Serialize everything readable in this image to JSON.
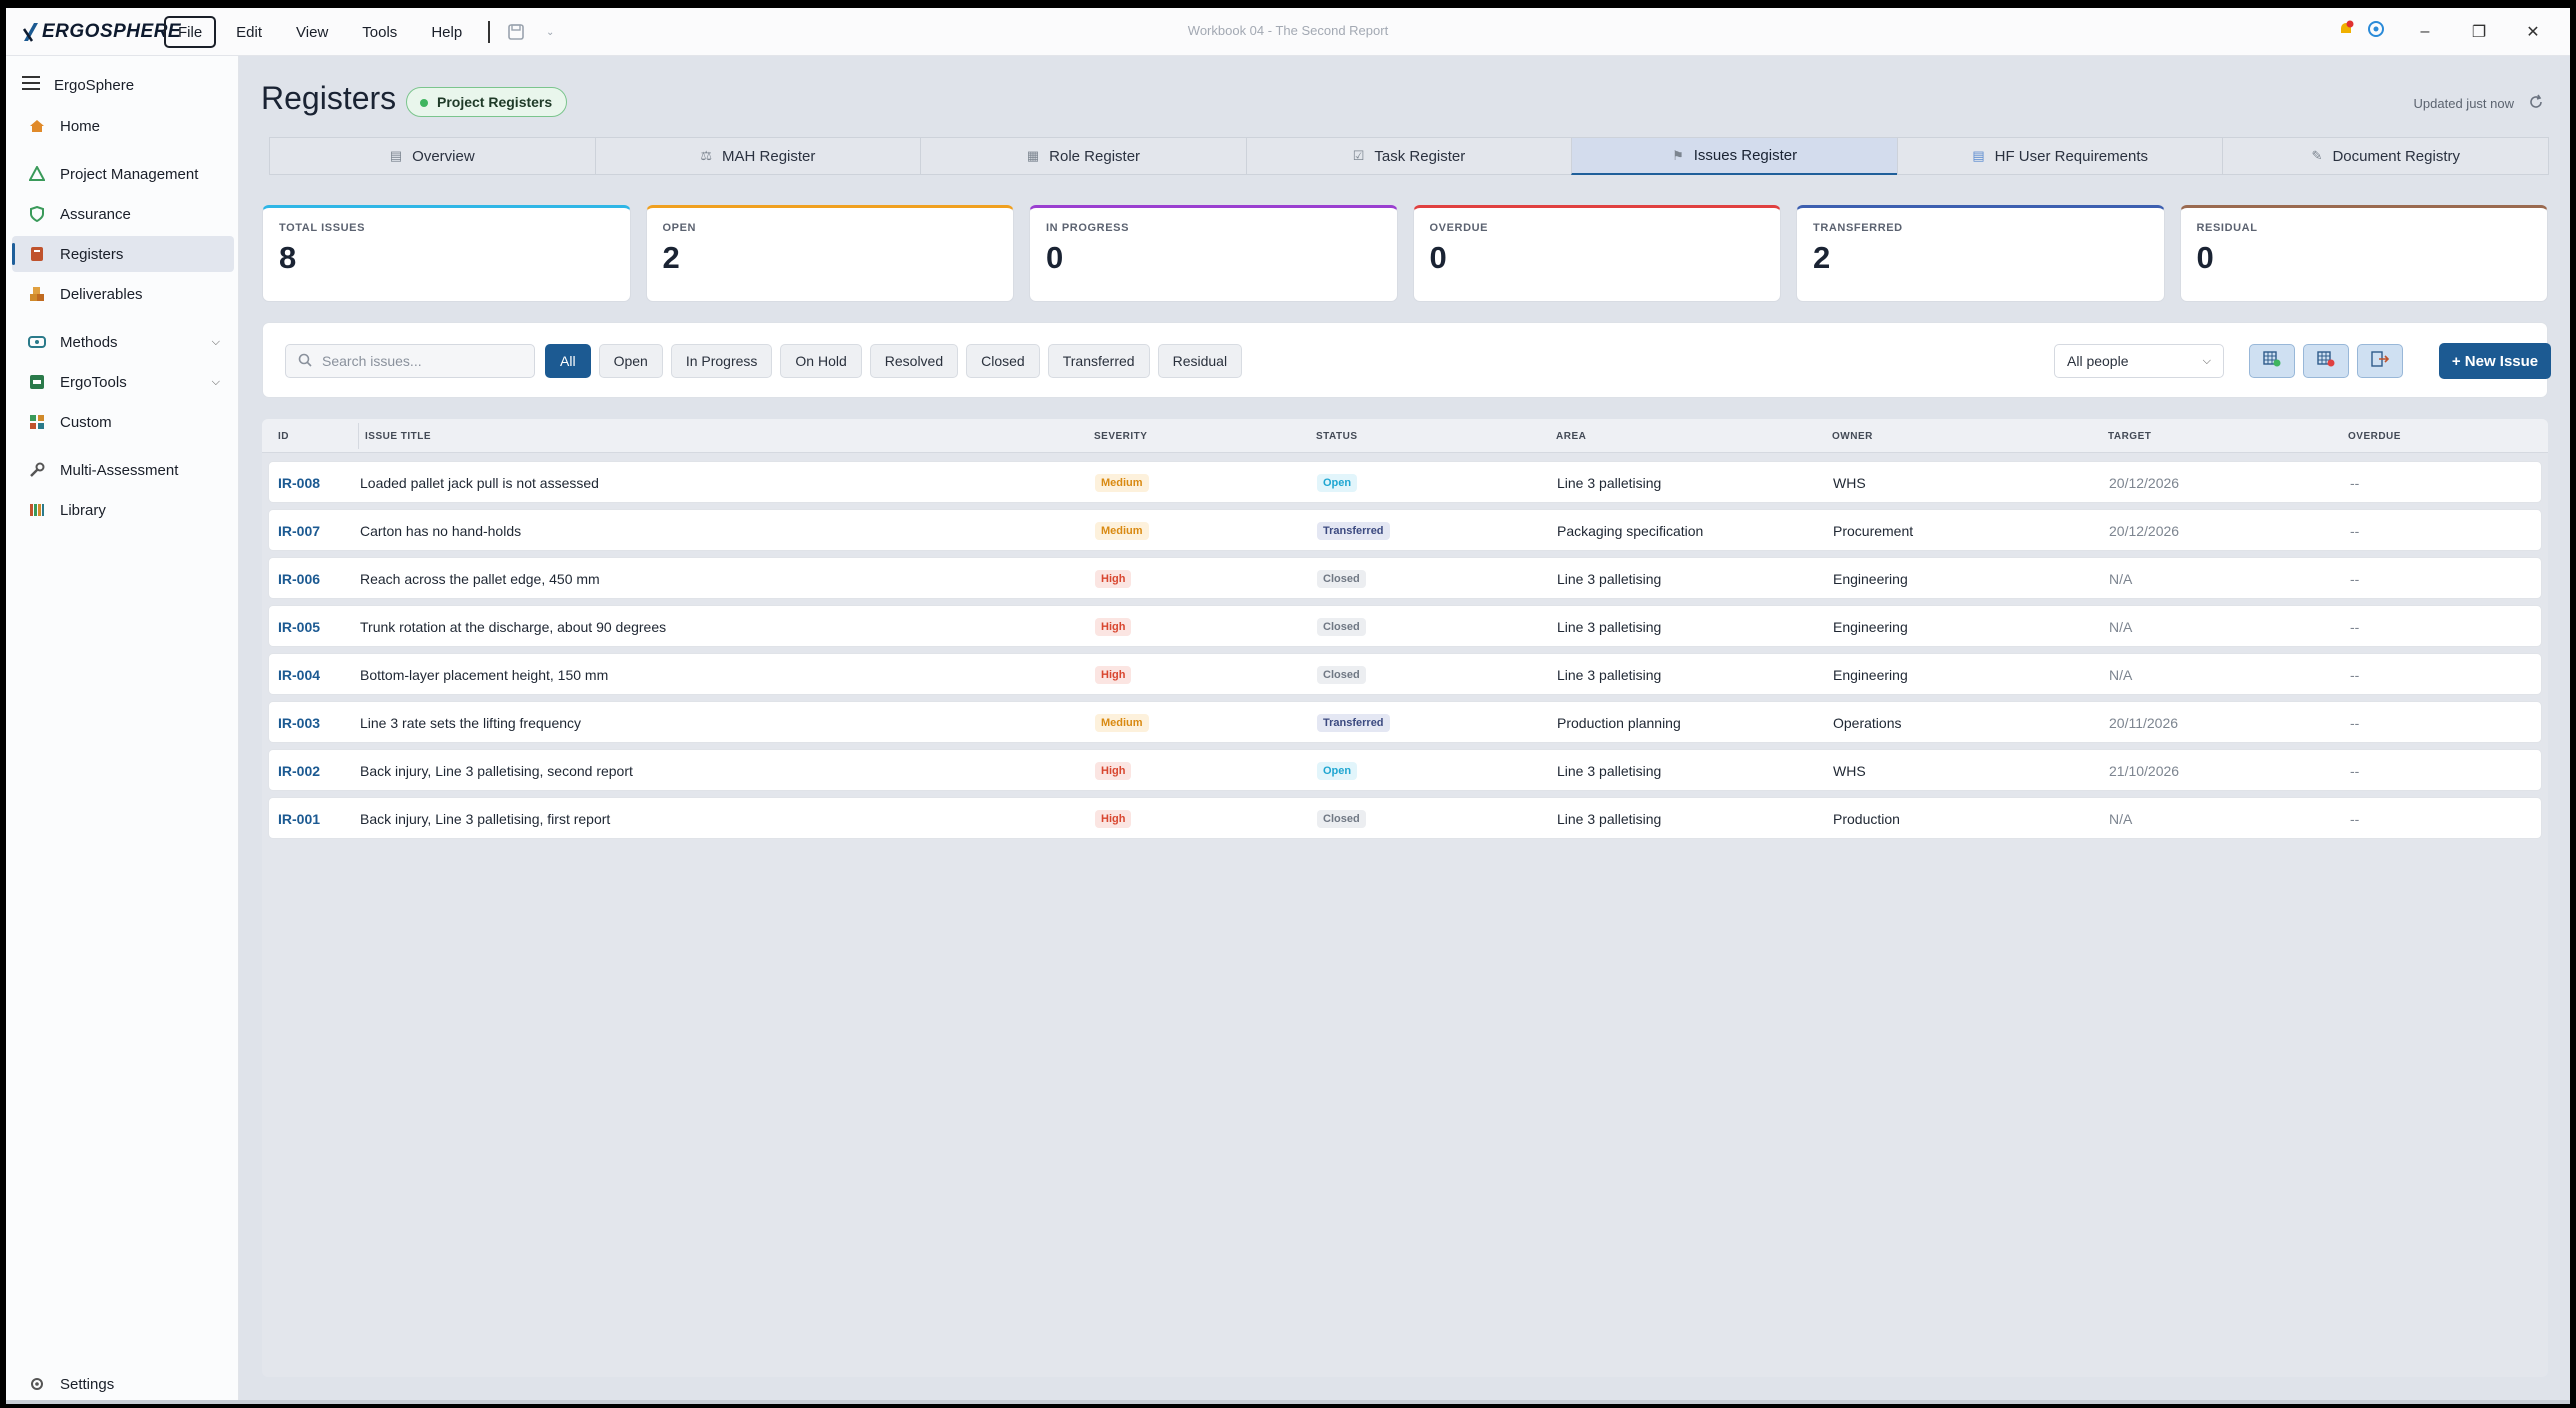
{
  "app": {
    "logo_text": "ERGOSPHERE",
    "window_title": "Workbook 04 - The Second Report"
  },
  "menu": [
    "File",
    "Edit",
    "View",
    "Tools",
    "Help"
  ],
  "sidebar": {
    "header": "ErgoSphere",
    "items": [
      {
        "label": "Home",
        "icon": "home-icon"
      },
      {
        "label": "Project Management",
        "icon": "project-icon"
      },
      {
        "label": "Assurance",
        "icon": "shield-icon"
      },
      {
        "label": "Registers",
        "icon": "book-icon",
        "active": true
      },
      {
        "label": "Deliverables",
        "icon": "boxes-icon"
      },
      {
        "label": "Methods",
        "icon": "methods-icon",
        "expandable": true
      },
      {
        "label": "ErgoTools",
        "icon": "tools-icon",
        "expandable": true
      },
      {
        "label": "Custom",
        "icon": "grid-icon"
      },
      {
        "label": "Multi-Assessment",
        "icon": "wrench-icon"
      },
      {
        "label": "Library",
        "icon": "library-icon"
      }
    ],
    "settings": "Settings"
  },
  "page": {
    "title": "Registers",
    "badge": "Project Registers",
    "updated": "Updated just now"
  },
  "tabs": [
    {
      "label": "Overview"
    },
    {
      "label": "MAH Register"
    },
    {
      "label": "Role Register"
    },
    {
      "label": "Task Register"
    },
    {
      "label": "Issues Register",
      "active": true
    },
    {
      "label": "HF User Requirements"
    },
    {
      "label": "Document Registry"
    }
  ],
  "cards": [
    {
      "label": "TOTAL ISSUES",
      "value": "8",
      "color": "#2fb6e6"
    },
    {
      "label": "OPEN",
      "value": "2",
      "color": "#f0a020"
    },
    {
      "label": "IN PROGRESS",
      "value": "0",
      "color": "#9a3fd0"
    },
    {
      "label": "OVERDUE",
      "value": "0",
      "color": "#e04040"
    },
    {
      "label": "TRANSFERRED",
      "value": "2",
      "color": "#3d5fb0"
    },
    {
      "label": "RESIDUAL",
      "value": "0",
      "color": "#9a6a50"
    }
  ],
  "toolbar": {
    "search_placeholder": "Search issues...",
    "filters": [
      "All",
      "Open",
      "In Progress",
      "On Hold",
      "Resolved",
      "Closed",
      "Transferred",
      "Residual"
    ],
    "people": "All people",
    "new_issue": "+ New Issue"
  },
  "table": {
    "headers": [
      "ID",
      "ISSUE TITLE",
      "SEVERITY",
      "STATUS",
      "AREA",
      "OWNER",
      "TARGET",
      "OVERDUE"
    ],
    "rows": [
      {
        "id": "IR-008",
        "title": "Loaded pallet jack pull is not assessed",
        "severity": "Medium",
        "status": "Open",
        "area": "Line 3 palletising",
        "owner": "WHS",
        "target": "20/12/2026",
        "overdue": "--"
      },
      {
        "id": "IR-007",
        "title": "Carton has no hand-holds",
        "severity": "Medium",
        "status": "Transferred",
        "area": "Packaging specification",
        "owner": "Procurement",
        "target": "20/12/2026",
        "overdue": "--"
      },
      {
        "id": "IR-006",
        "title": "Reach across the pallet edge, 450 mm",
        "severity": "High",
        "status": "Closed",
        "area": "Line 3 palletising",
        "owner": "Engineering",
        "target": "N/A",
        "overdue": "--"
      },
      {
        "id": "IR-005",
        "title": "Trunk rotation at the discharge, about 90 degrees",
        "severity": "High",
        "status": "Closed",
        "area": "Line 3 palletising",
        "owner": "Engineering",
        "target": "N/A",
        "overdue": "--"
      },
      {
        "id": "IR-004",
        "title": "Bottom-layer placement height, 150 mm",
        "severity": "High",
        "status": "Closed",
        "area": "Line 3 palletising",
        "owner": "Engineering",
        "target": "N/A",
        "overdue": "--"
      },
      {
        "id": "IR-003",
        "title": "Line 3 rate sets the lifting frequency",
        "severity": "Medium",
        "status": "Transferred",
        "area": "Production planning",
        "owner": "Operations",
        "target": "20/11/2026",
        "overdue": "--"
      },
      {
        "id": "IR-002",
        "title": "Back injury, Line 3 palletising, second report",
        "severity": "High",
        "status": "Open",
        "area": "Line 3 palletising",
        "owner": "WHS",
        "target": "21/10/2026",
        "overdue": "--"
      },
      {
        "id": "IR-001",
        "title": "Back injury, Line 3 palletising, first report",
        "severity": "High",
        "status": "Closed",
        "area": "Line 3 palletising",
        "owner": "Production",
        "target": "N/A",
        "overdue": "--"
      }
    ]
  }
}
